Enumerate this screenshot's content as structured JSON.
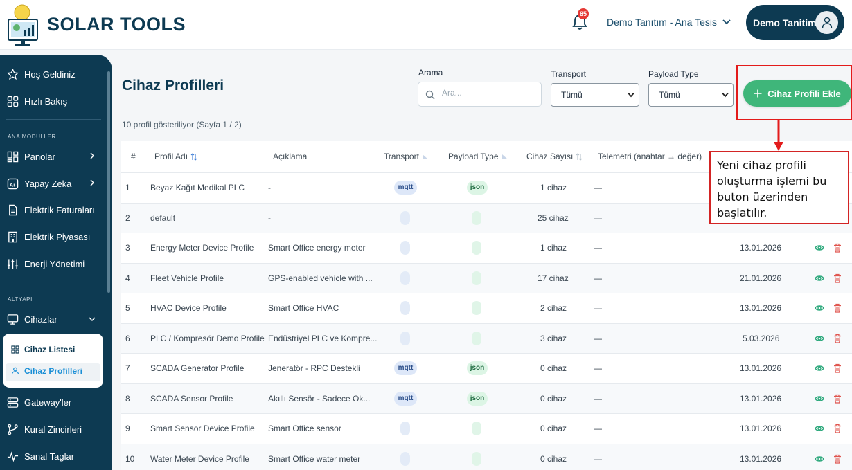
{
  "header": {
    "brand": "SOLAR TOOLS",
    "notification_count": "85",
    "facility": "Demo Tanıtım - Ana Tesis",
    "user_name": "Demo Tanitim"
  },
  "sidebar": {
    "items_top": [
      {
        "label": "Hoş Geldiniz",
        "icon": "star-icon"
      },
      {
        "label": "Hızlı Bakış",
        "icon": "grid-icon"
      }
    ],
    "section_modules": "ANA MODÜLLER",
    "items_modules": [
      {
        "label": "Panolar",
        "icon": "dashboard-icon"
      },
      {
        "label": "Yapay Zeka",
        "icon": "ai-icon"
      },
      {
        "label": "Elektrik Faturaları",
        "icon": "invoice-icon"
      },
      {
        "label": "Elektrik Piyasası",
        "icon": "building-icon"
      },
      {
        "label": "Enerji Yönetimi",
        "icon": "sliders-icon"
      }
    ],
    "section_infra": "ALTYAPI",
    "devices": "Cihazlar",
    "device_sub": [
      {
        "label": "Cihaz Listesi"
      },
      {
        "label": "Cihaz Profilleri"
      }
    ],
    "items_bottom": [
      {
        "label": "Gateway'ler",
        "icon": "server-icon"
      },
      {
        "label": "Kural Zincirleri",
        "icon": "branch-icon"
      },
      {
        "label": "Sanal Taglar",
        "icon": "pulse-icon"
      }
    ]
  },
  "main": {
    "title": "Cihaz Profilleri",
    "count_text": "10 profil gösteriliyor (Sayfa 1 / 2)",
    "filters": {
      "search_label": "Arama",
      "search_placeholder": "Ara...",
      "transport_label": "Transport",
      "transport_value": "Tümü",
      "payload_label": "Payload Type",
      "payload_value": "Tümü"
    },
    "add_button": "Cihaz Profili Ekle",
    "callout": "Yeni cihaz  profili oluşturma işlemi bu buton üzerinden başlatılır."
  },
  "table": {
    "headers": {
      "num": "#",
      "name": "Profil Adı",
      "desc": "Açıklama",
      "transport": "Transport",
      "payload": "Payload Type",
      "count": "Cihaz Sayısı",
      "telemetry": "Telemetri (anahtar → değer)"
    },
    "rows": [
      {
        "num": "1",
        "name": "Beyaz Kağıt Medikal PLC",
        "desc": "-",
        "transport": "mqtt",
        "payload": "json",
        "count": "1 cihaz",
        "telemetry": "—",
        "date": ""
      },
      {
        "num": "2",
        "name": "default",
        "desc": "-",
        "transport": "",
        "payload": "",
        "count": "25 cihaz",
        "telemetry": "—",
        "date": ""
      },
      {
        "num": "3",
        "name": "Energy Meter Device Profile",
        "desc": "Smart Office energy meter",
        "transport": "",
        "payload": "",
        "count": "1 cihaz",
        "telemetry": "—",
        "date": "13.01.2026"
      },
      {
        "num": "4",
        "name": "Fleet Vehicle Profile",
        "desc": "GPS-enabled vehicle with ...",
        "transport": "",
        "payload": "",
        "count": "17 cihaz",
        "telemetry": "—",
        "date": "21.01.2026"
      },
      {
        "num": "5",
        "name": "HVAC Device Profile",
        "desc": "Smart Office HVAC",
        "transport": "",
        "payload": "",
        "count": "2 cihaz",
        "telemetry": "—",
        "date": "13.01.2026"
      },
      {
        "num": "6",
        "name": "PLC / Kompresör Demo Profile",
        "desc": "Endüstriyel PLC ve Kompre...",
        "transport": "",
        "payload": "",
        "count": "3 cihaz",
        "telemetry": "—",
        "date": "5.03.2026"
      },
      {
        "num": "7",
        "name": "SCADA Generator Profile",
        "desc": "Jeneratör - RPC Destekli",
        "transport": "mqtt",
        "payload": "json",
        "count": "0 cihaz",
        "telemetry": "—",
        "date": "13.01.2026"
      },
      {
        "num": "8",
        "name": "SCADA Sensor Profile",
        "desc": "Akıllı Sensör - Sadece Ok...",
        "transport": "mqtt",
        "payload": "json",
        "count": "0 cihaz",
        "telemetry": "—",
        "date": "13.01.2026"
      },
      {
        "num": "9",
        "name": "Smart Sensor Device Profile",
        "desc": "Smart Office sensor",
        "transport": "",
        "payload": "",
        "count": "0 cihaz",
        "telemetry": "—",
        "date": "13.01.2026"
      },
      {
        "num": "10",
        "name": "Water Meter Device Profile",
        "desc": "Smart Office water meter",
        "transport": "",
        "payload": "",
        "count": "0 cihaz",
        "telemetry": "—",
        "date": "13.01.2026"
      }
    ]
  },
  "colors": {
    "navy": "#0d3a52",
    "green": "#3fb67a",
    "red": "#e31b1b"
  }
}
